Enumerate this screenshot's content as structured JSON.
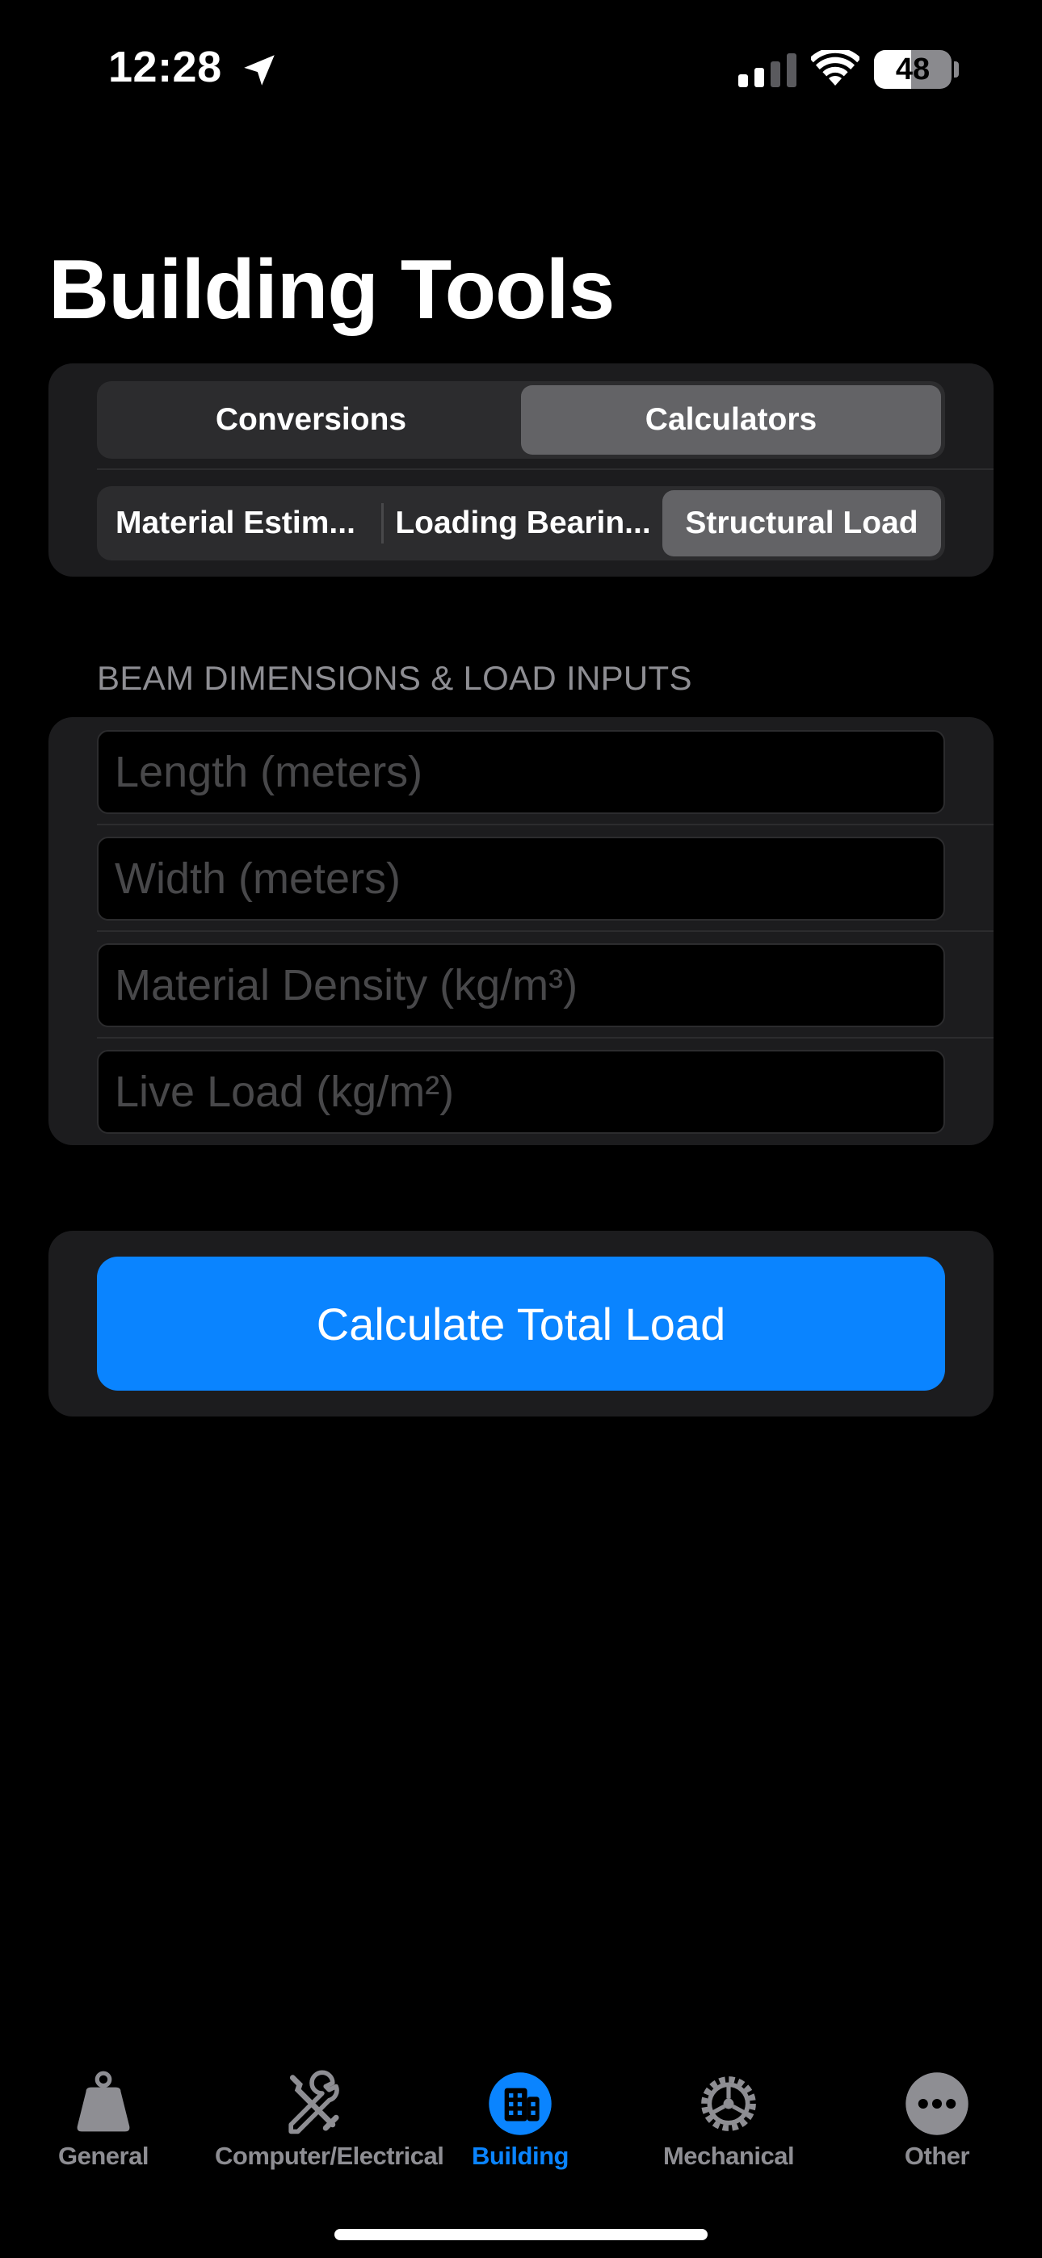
{
  "status_bar": {
    "time": "12:28",
    "battery": "48",
    "battery_level": 0.48
  },
  "page_title": "Building Tools",
  "mode_segments": [
    {
      "label": "Conversions",
      "active": false
    },
    {
      "label": "Calculators",
      "active": true
    }
  ],
  "calculator_segments": [
    {
      "label": "Material Estim...",
      "active": false
    },
    {
      "label": "Loading Bearin...",
      "active": false
    },
    {
      "label": "Structural Load",
      "active": true
    }
  ],
  "section_header": "BEAM DIMENSIONS & LOAD INPUTS",
  "inputs": [
    {
      "placeholder": "Length (meters)",
      "value": ""
    },
    {
      "placeholder": "Width (meters)",
      "value": ""
    },
    {
      "placeholder": "Material Density (kg/m³)",
      "value": ""
    },
    {
      "placeholder": "Live Load (kg/m²)",
      "value": ""
    }
  ],
  "action_button": "Calculate Total Load",
  "tabs": [
    {
      "label": "General",
      "icon": "weight-icon",
      "active": false
    },
    {
      "label": "Computer/Electrical",
      "icon": "tools-icon",
      "active": false
    },
    {
      "label": "Building",
      "icon": "building-icon",
      "active": true
    },
    {
      "label": "Mechanical",
      "icon": "gear-icon",
      "active": false
    },
    {
      "label": "Other",
      "icon": "more-icon",
      "active": false
    }
  ],
  "colors": {
    "accent": "#0a84ff",
    "background": "#000000",
    "card": "#1c1c1e",
    "segment_active": "#636366",
    "inactive_tab": "#8e8e93"
  }
}
